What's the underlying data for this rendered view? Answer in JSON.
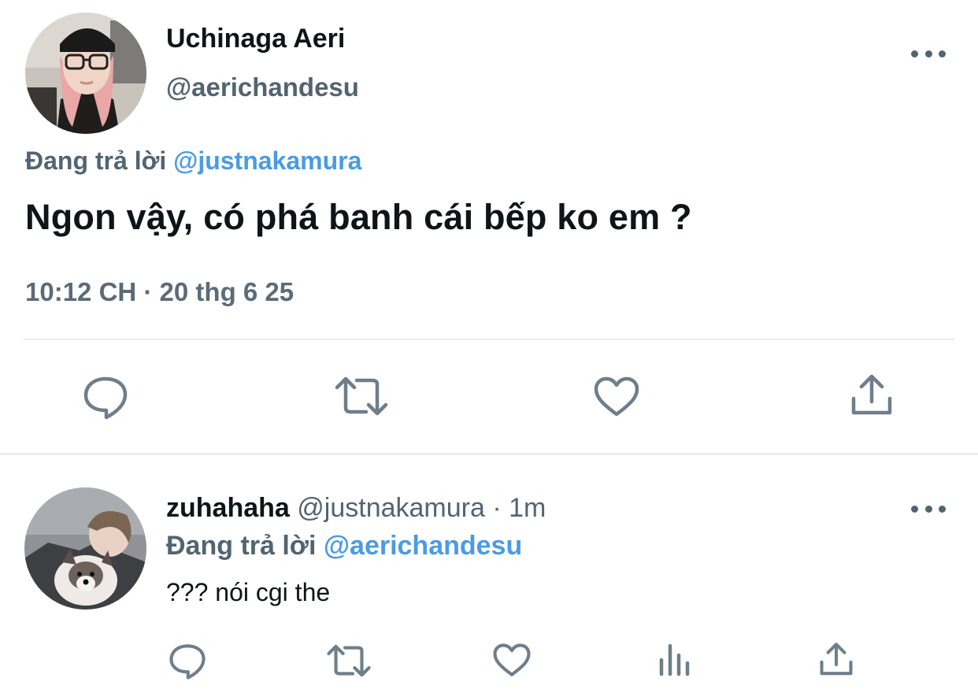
{
  "main_tweet": {
    "author_name": "Uchinaga Aeri",
    "author_handle": "@aerichandesu",
    "replying_prefix": "Đang trả lời",
    "replying_to": "@justnakamura",
    "text": "Ngon vậy, có phá banh cái bếp ko em ?",
    "meta": "10:12 CH · 20 thg 6 25",
    "actions": [
      "reply-icon",
      "retweet-icon",
      "like-icon",
      "share-icon"
    ]
  },
  "reply_tweet": {
    "author_name": "zuhahaha",
    "author_handle": "@justnakamura",
    "separator": "·",
    "time": "1m",
    "replying_prefix": "Đang trả lời",
    "replying_to": "@aerichandesu",
    "text": "??? nói cgi the",
    "actions": [
      "reply-icon",
      "retweet-icon",
      "like-icon",
      "analytics-icon",
      "share-icon"
    ]
  },
  "colors": {
    "text_primary": "#0f1419",
    "text_secondary": "#536471",
    "mention": "#4a9be3",
    "icon": "#6e7e8b",
    "divider": "#e8ebed"
  }
}
